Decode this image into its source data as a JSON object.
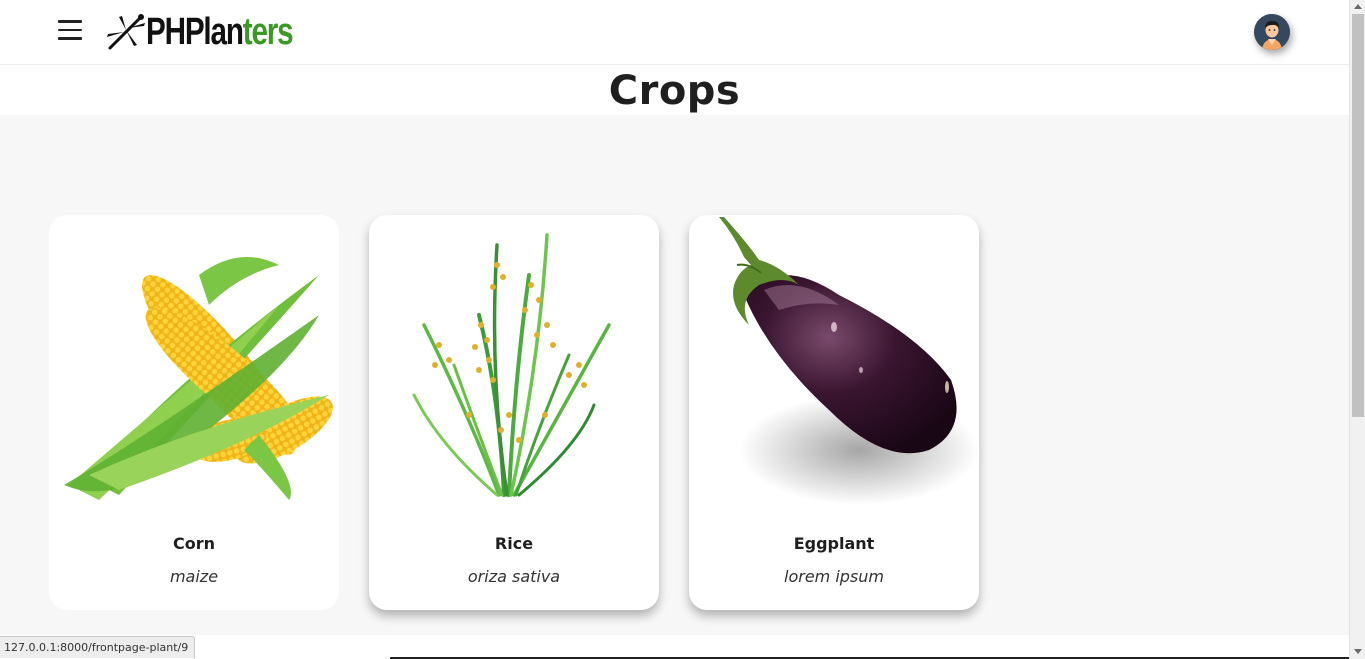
{
  "header": {
    "logo": {
      "part1": "PHPlan",
      "part2": "ters"
    },
    "menu_icon": "hamburger-icon",
    "avatar_icon": "user-avatar-icon"
  },
  "page": {
    "title": "Crops"
  },
  "crops": [
    {
      "name": "Corn",
      "scientific_name": "maize",
      "image": "corn-image"
    },
    {
      "name": "Rice",
      "scientific_name": "oriza sativa",
      "image": "rice-image"
    },
    {
      "name": "Eggplant",
      "scientific_name": "lorem ipsum",
      "image": "eggplant-image"
    }
  ],
  "status_bar": {
    "url": "127.0.0.1:8000/frontpage-plant/9"
  },
  "colors": {
    "brand_green": "#3a9a25",
    "background": "#f7f7f7",
    "card": "#ffffff",
    "text": "#1f1f1f"
  }
}
